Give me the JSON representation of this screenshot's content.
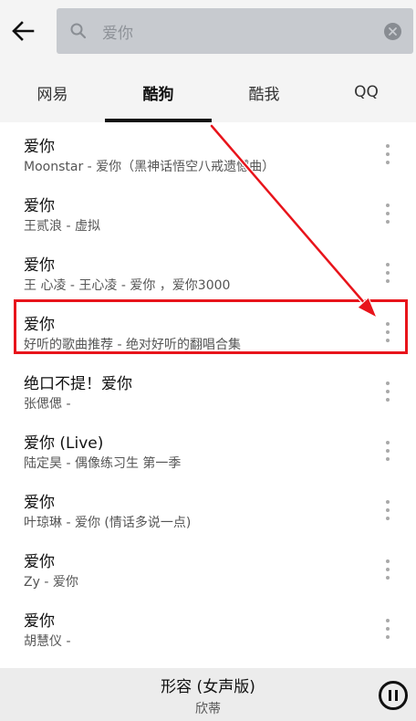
{
  "search": {
    "value": "爱你"
  },
  "tabs": [
    {
      "label": "网易"
    },
    {
      "label": "酷狗"
    },
    {
      "label": "酷我"
    },
    {
      "label": "QQ"
    }
  ],
  "active_tab": "酷狗",
  "results": [
    {
      "title": "爱你",
      "subtitle": "Moonstar - 爱你（黑神话悟空八戒遗憾曲）"
    },
    {
      "title": "爱你",
      "subtitle": "王贰浪 - 虚拟"
    },
    {
      "title": "爱你",
      "subtitle": "王 心凌 - 王心凌 - 爱你 ，爱你3000"
    },
    {
      "title": "爱你",
      "subtitle": "好听的歌曲推荐 - 绝对好听的翻唱合集"
    },
    {
      "title": "绝口不提！爱你",
      "subtitle": "张偲偲 -"
    },
    {
      "title": "爱你 (Live)",
      "subtitle": "陆定昊 - 偶像练习生 第一季"
    },
    {
      "title": "爱你",
      "subtitle": "叶琼琳 - 爱你 (情话多说一点)"
    },
    {
      "title": "爱你",
      "subtitle": "Zy - 爱你"
    },
    {
      "title": "爱你",
      "subtitle": "胡慧仪 -"
    }
  ],
  "highlighted_result": 3,
  "player": {
    "song": "形容 (女声版)",
    "artist": "欣蒂"
  },
  "icons": {
    "back": "arrow-left-icon",
    "search": "search-icon",
    "clear": "clear-icon",
    "more": "more-vertical-icon",
    "pause": "pause-icon"
  },
  "colors": {
    "highlight": "#e8141b",
    "search_bg": "#c7cacf"
  }
}
